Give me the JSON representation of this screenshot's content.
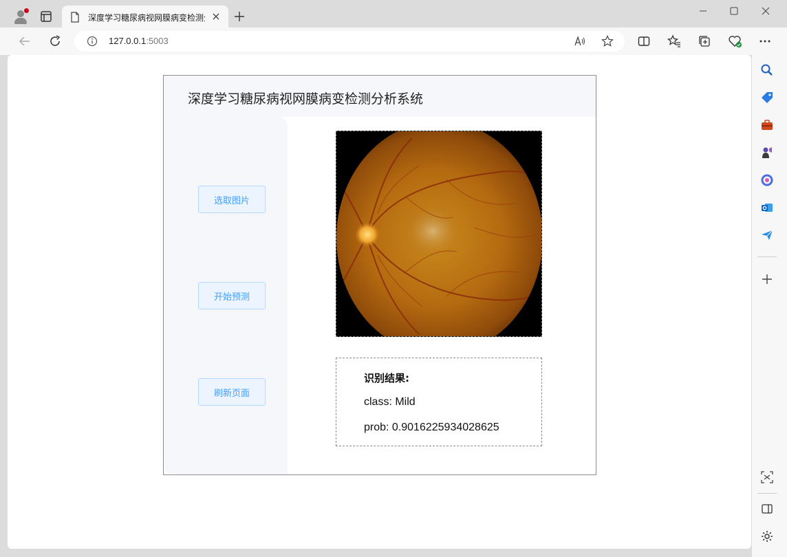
{
  "browser": {
    "tab_title": "深度学习糖尿病视网膜病变检测分析系统",
    "url_host": "127.0.0.1",
    "url_port": ":5003"
  },
  "app": {
    "title": "深度学习糖尿病视网膜病变检测分析系统",
    "buttons": {
      "select": "选取图片",
      "predict": "开始预测",
      "refresh": "刷新页面"
    },
    "result": {
      "heading": "识别结果:",
      "class_line": "class: Mild",
      "prob_line": "prob: 0.9016225934028625"
    }
  },
  "colors": {
    "button_text": "#409eff",
    "button_bg": "#ecf5ff",
    "button_border": "#b3d8ff",
    "panel_bg": "#f5f7fa"
  },
  "icons": {
    "profile": "profile-icon",
    "tabs": "tab-actions-icon",
    "doc": "page-icon",
    "back": "back-arrow-icon",
    "refresh": "refresh-icon",
    "info": "info-icon",
    "read_aloud": "read-aloud-icon",
    "favorite": "star-icon"
  }
}
